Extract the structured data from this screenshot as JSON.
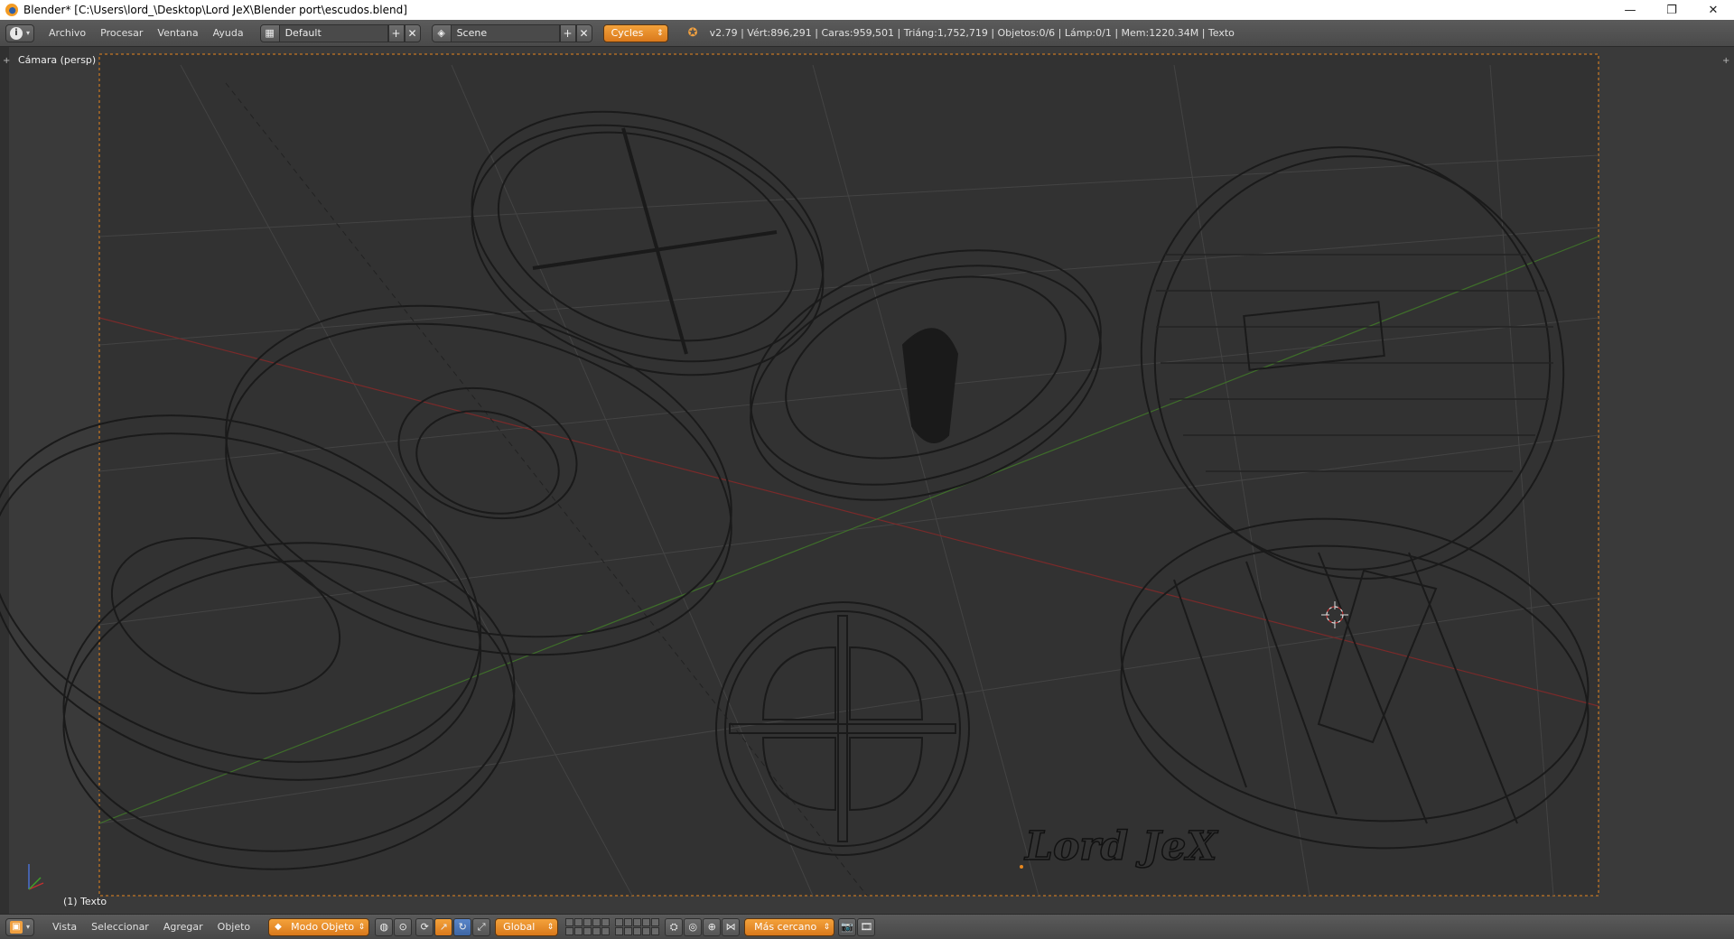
{
  "window": {
    "title": "Blender* [C:\\Users\\lord_\\Desktop\\Lord JeX\\Blender port\\escudos.blend]",
    "minimize": "—",
    "restore": "❐",
    "close": "✕"
  },
  "info_header": {
    "menus": [
      "Archivo",
      "Procesar",
      "Ventana",
      "Ayuda"
    ],
    "screen_layout": "Default",
    "scene": "Scene",
    "render_engine": "Cycles",
    "stats": "v2.79 | Vért:896,291 | Caras:959,501 | Triáng:1,752,719 | Objetos:0/6 | Lámp:0/1 | Mem:1220.34M | Texto"
  },
  "viewport": {
    "view_label": "Cámara (persp)",
    "active_object": "(1) Texto",
    "watermark_text": "Lord JeX"
  },
  "bottom_header": {
    "menus": [
      "Vista",
      "Seleccionar",
      "Agregar",
      "Objeto"
    ],
    "mode": "Modo Objeto",
    "transform_orientation": "Global",
    "snap_target": "Más cercano"
  },
  "colors": {
    "accent": "#e8871e",
    "header": "#4f4f4f",
    "viewport_bg": "#3a3a3a",
    "camera_bg": "#323232",
    "wire": "#1a1a1a"
  }
}
